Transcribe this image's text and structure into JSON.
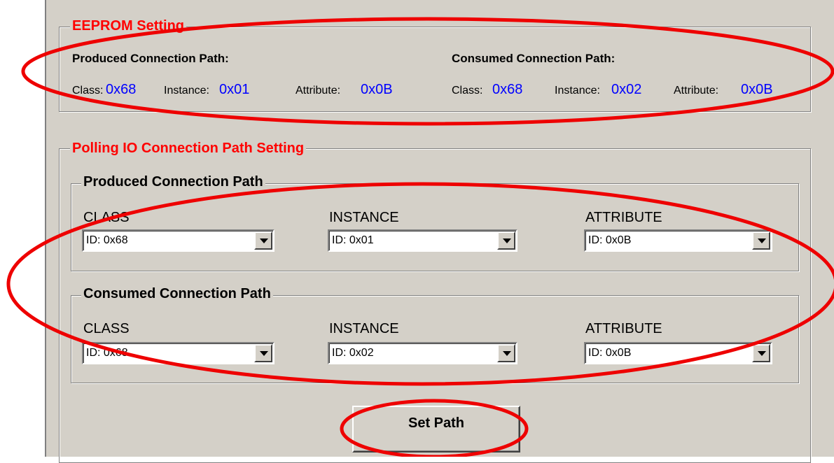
{
  "eeprom": {
    "legend": "EEPROM Setting",
    "produced": {
      "title": "Produced Connection Path:",
      "class_label": "Class:",
      "class_value": "0x68",
      "instance_label": "Instance:",
      "instance_value": "0x01",
      "attribute_label": "Attribute:",
      "attribute_value": "0x0B"
    },
    "consumed": {
      "title": "Consumed Connection Path:",
      "class_label": "Class:",
      "class_value": "0x68",
      "instance_label": "Instance:",
      "instance_value": "0x02",
      "attribute_label": "Attribute:",
      "attribute_value": "0x0B"
    }
  },
  "polling": {
    "legend": "Polling IO Connection Path Setting",
    "produced": {
      "legend": "Produced Connection Path",
      "class_label": "CLASS",
      "class_value": "ID: 0x68",
      "instance_label": "INSTANCE",
      "instance_value": "ID: 0x01",
      "attribute_label": "ATTRIBUTE",
      "attribute_value": "ID: 0x0B"
    },
    "consumed": {
      "legend": "Consumed Connection Path",
      "class_label": "CLASS",
      "class_value": "ID: 0x68",
      "instance_label": "INSTANCE",
      "instance_value": "ID: 0x02",
      "attribute_label": "ATTRIBUTE",
      "attribute_value": "ID: 0x0B"
    }
  },
  "set_path_label": "Set Path",
  "colors": {
    "panel_bg": "#d4d0c8",
    "legend_red": "#ff0000",
    "value_blue": "#0000ff",
    "annotation_red": "#ee0000"
  },
  "icons": {
    "dropdown": "chevron-down-icon"
  }
}
